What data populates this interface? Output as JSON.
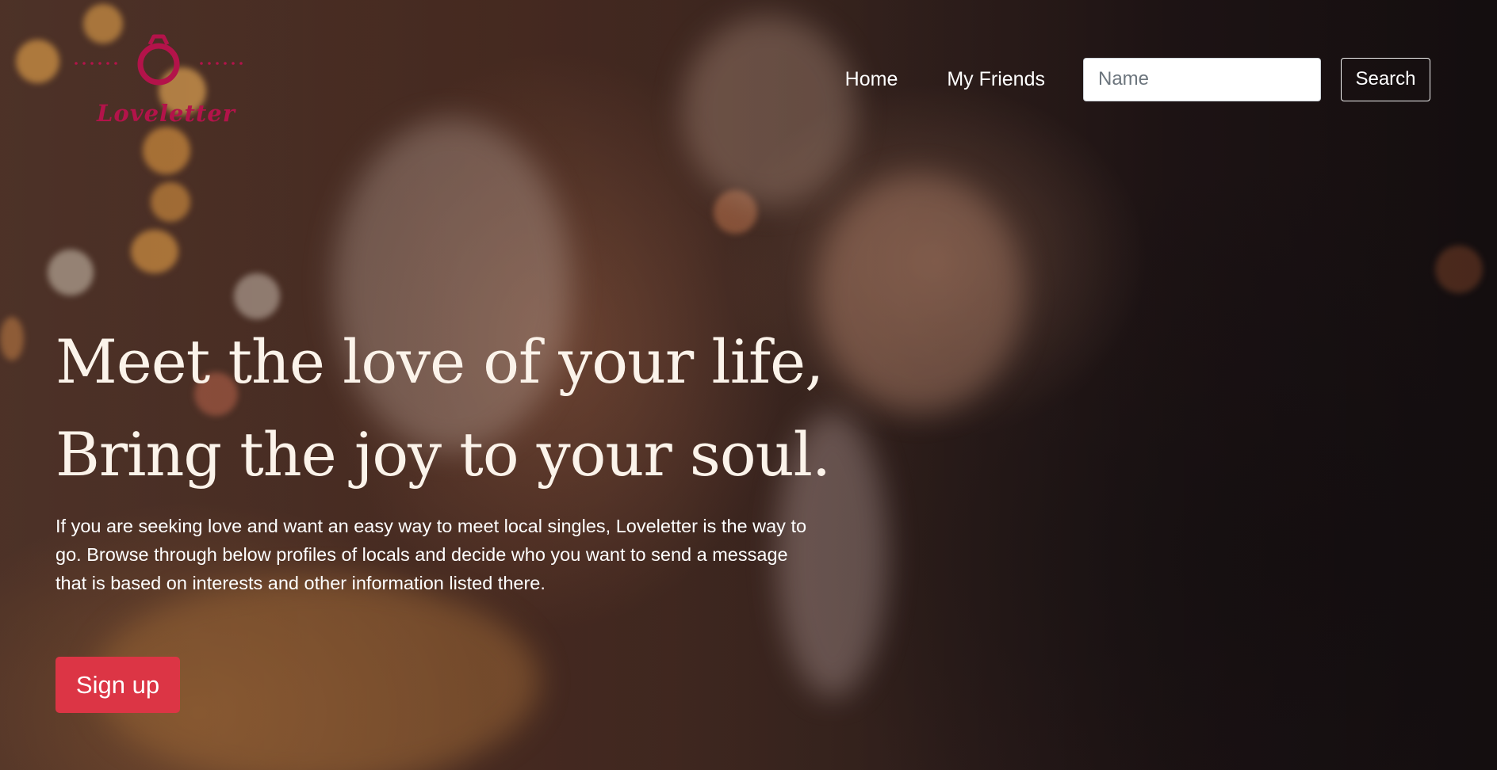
{
  "brand": {
    "name": "Loveletter",
    "color": "#b3134a",
    "icon": "ring-icon"
  },
  "nav": {
    "links": [
      {
        "label": "Home"
      },
      {
        "label": "My Friends"
      }
    ],
    "search": {
      "placeholder": "Name",
      "value": "",
      "button_label": "Search"
    }
  },
  "hero": {
    "headline_line1": "Meet the love of your life,",
    "headline_line2": "Bring the joy to your soul.",
    "lead": "If you are seeking love and want an easy way to meet local singles, Loveletter is the way to go. Browse through below profiles of locals and decide who you want to send a message that is based on interests and other information listed there.",
    "cta_label": "Sign up",
    "cta_color": "#dc3545"
  }
}
